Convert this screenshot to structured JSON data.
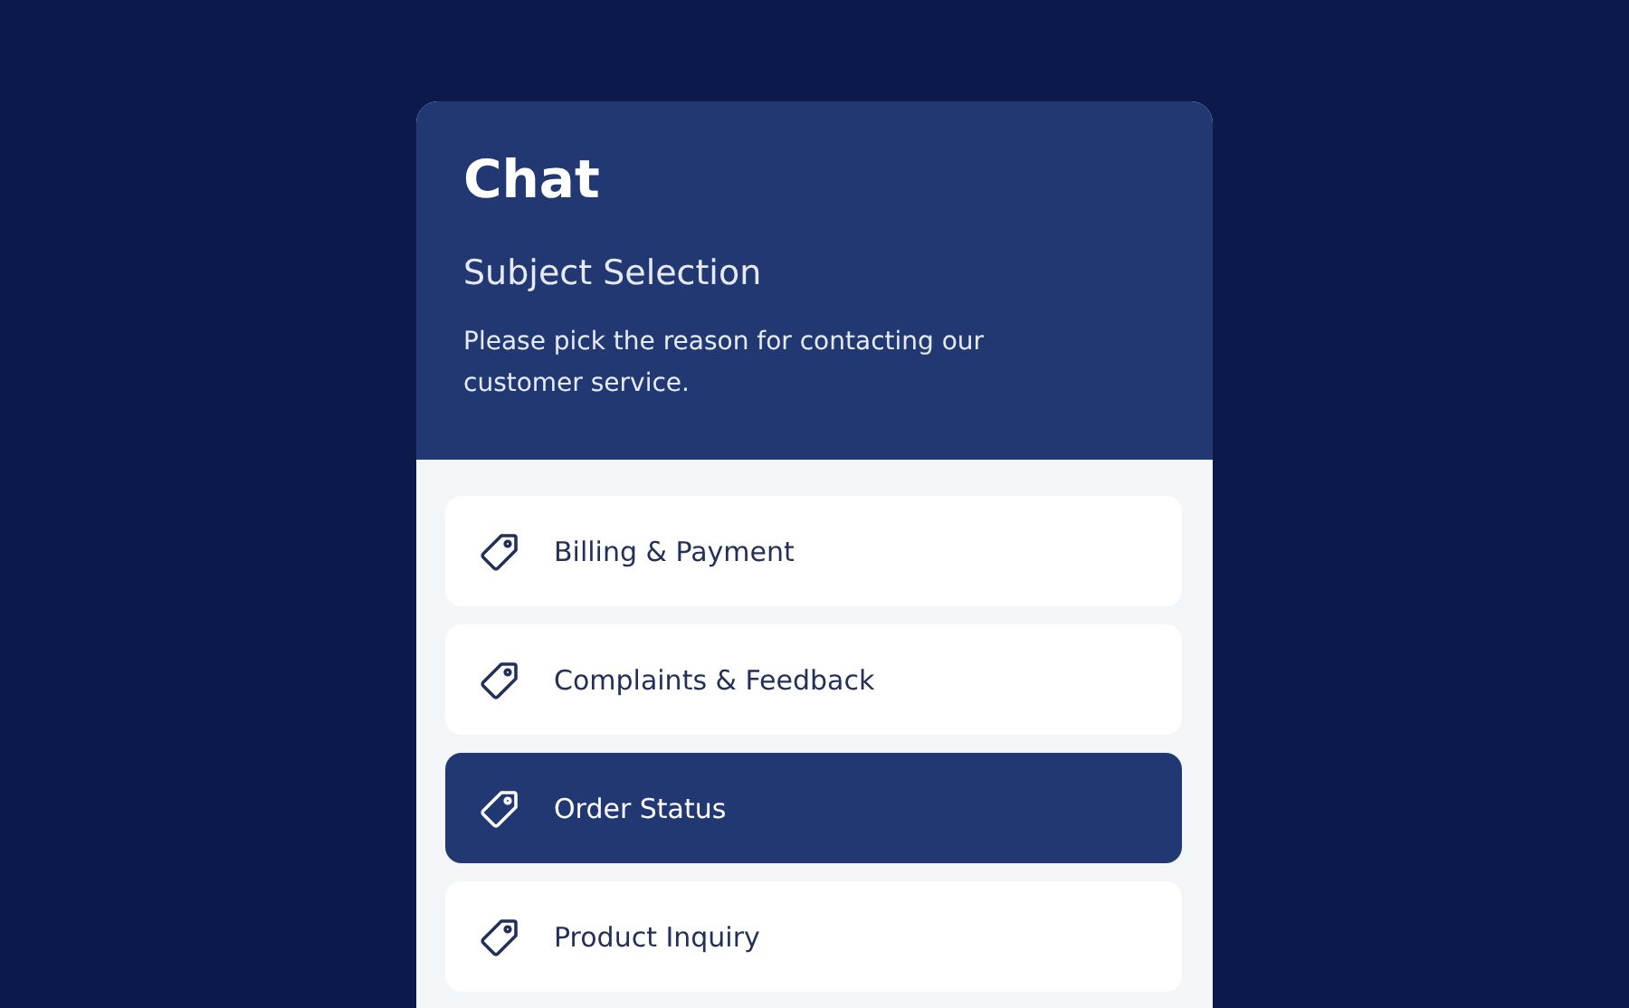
{
  "title": "Chat",
  "subtitle": "Subject Selection",
  "description": "Please pick the reason for contacting our customer service.",
  "subjects": [
    {
      "label": "Billing & Payment",
      "selected": false
    },
    {
      "label": "Complaints & Feedback",
      "selected": false
    },
    {
      "label": "Order Status",
      "selected": true
    },
    {
      "label": "Product Inquiry",
      "selected": false
    }
  ]
}
